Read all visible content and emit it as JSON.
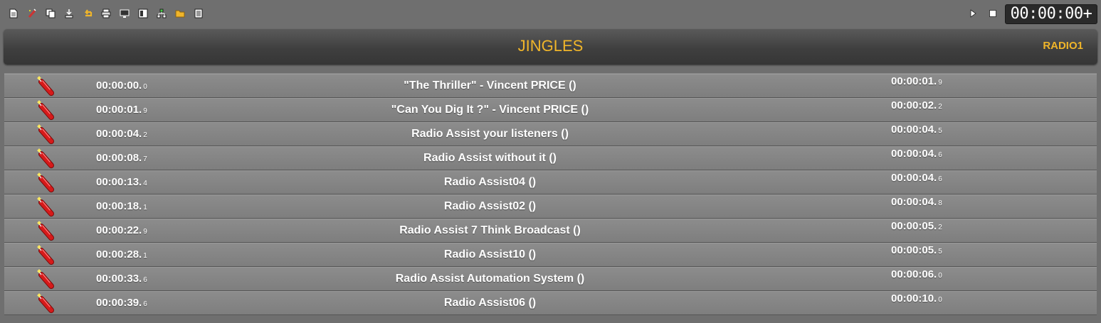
{
  "toolbar": {
    "tools": [
      {
        "name": "new-document-icon"
      },
      {
        "name": "edit-wand-icon"
      },
      {
        "name": "copy-icon"
      },
      {
        "name": "download-icon"
      },
      {
        "name": "undo-arrow-icon"
      },
      {
        "name": "print-icon"
      },
      {
        "name": "monitor-icon"
      },
      {
        "name": "info-card-icon"
      },
      {
        "name": "network-icon"
      },
      {
        "name": "folder-icon"
      },
      {
        "name": "list-icon"
      }
    ],
    "clock": "00:00:00+"
  },
  "header": {
    "title": "JINGLES",
    "station": "RADIO1"
  },
  "colors": {
    "accent": "#f0b52a",
    "row": "#868686",
    "background": "#6f6f6f"
  },
  "jingles": [
    {
      "start": "00:00:00.",
      "start_tenth": "0",
      "title": "\"The Thriller\" - Vincent PRICE ()",
      "duration": "00:00:01.",
      "duration_tenth": "9"
    },
    {
      "start": "00:00:01.",
      "start_tenth": "9",
      "title": "\"Can You Dig It ?\" - Vincent PRICE ()",
      "duration": "00:00:02.",
      "duration_tenth": "2"
    },
    {
      "start": "00:00:04.",
      "start_tenth": "2",
      "title": "Radio Assist your listeners ()",
      "duration": "00:00:04.",
      "duration_tenth": "5"
    },
    {
      "start": "00:00:08.",
      "start_tenth": "7",
      "title": "Radio Assist without it ()",
      "duration": "00:00:04.",
      "duration_tenth": "6"
    },
    {
      "start": "00:00:13.",
      "start_tenth": "4",
      "title": "Radio Assist04 ()",
      "duration": "00:00:04.",
      "duration_tenth": "6"
    },
    {
      "start": "00:00:18.",
      "start_tenth": "1",
      "title": "Radio Assist02 ()",
      "duration": "00:00:04.",
      "duration_tenth": "8"
    },
    {
      "start": "00:00:22.",
      "start_tenth": "9",
      "title": "Radio Assist 7 Think Broadcast ()",
      "duration": "00:00:05.",
      "duration_tenth": "2"
    },
    {
      "start": "00:00:28.",
      "start_tenth": "1",
      "title": "Radio Assist10 ()",
      "duration": "00:00:05.",
      "duration_tenth": "5"
    },
    {
      "start": "00:00:33.",
      "start_tenth": "6",
      "title": "Radio Assist Automation System ()",
      "duration": "00:00:06.",
      "duration_tenth": "0"
    },
    {
      "start": "00:00:39.",
      "start_tenth": "6",
      "title": "Radio Assist06 ()",
      "duration": "00:00:10.",
      "duration_tenth": "0"
    }
  ]
}
